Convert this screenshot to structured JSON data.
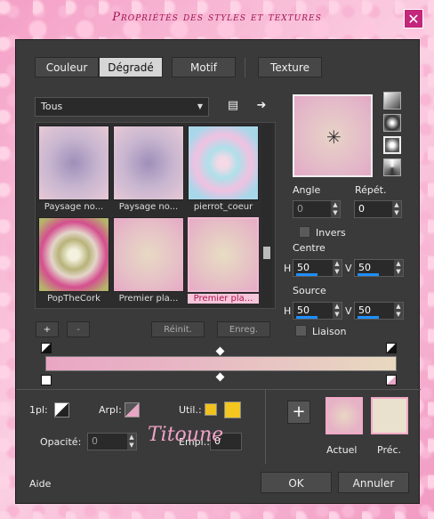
{
  "window": {
    "title": "Propriétés des styles et textures",
    "close": "✕"
  },
  "tabs": [
    {
      "label": "Couleur",
      "active": false
    },
    {
      "label": "Dégradé",
      "active": true
    },
    {
      "label": "Motif",
      "active": false
    },
    {
      "label": "Texture",
      "active": false
    }
  ],
  "category": {
    "value": "Tous"
  },
  "thumbnails": [
    {
      "label": "Paysage no..."
    },
    {
      "label": "Paysage no..."
    },
    {
      "label": "pierrot_coeur"
    },
    {
      "label": "PopTheCork"
    },
    {
      "label": "Premier pla..."
    },
    {
      "label": "Premier pla...",
      "selected": true
    }
  ],
  "grid_buttons": {
    "add": "+",
    "remove": "-",
    "reset": "Réinit.",
    "save": "Enreg."
  },
  "angle": {
    "label": "Angle",
    "value": "0"
  },
  "repeat": {
    "label": "Répét.",
    "value": "0"
  },
  "invert": {
    "label": "Invers"
  },
  "centre": {
    "label": "Centre",
    "h_label": "H",
    "h": "50",
    "v_label": "V",
    "v": "50"
  },
  "source": {
    "label": "Source",
    "h_label": "H",
    "h": "50",
    "v_label": "V",
    "v": "50"
  },
  "link": {
    "label": "Liaison"
  },
  "bottom": {
    "ipl": "1pl:",
    "arpl": "Arpl:",
    "util": "Util.:",
    "opacity_label": "Opacité:",
    "opacity_value": "0",
    "empl_label": "Empl.:",
    "empl_value": "0",
    "current": "Actuel",
    "previous": "Préc.",
    "add": "+"
  },
  "footer": {
    "help": "Aide",
    "ok": "OK",
    "cancel": "Annuler",
    "signature": "Titoune"
  }
}
